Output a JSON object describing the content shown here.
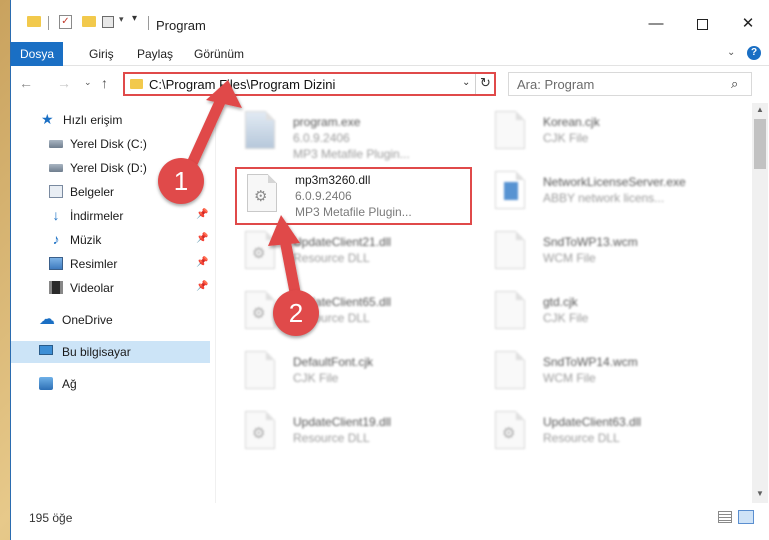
{
  "window": {
    "title": "Program",
    "controls": {
      "minimize": "—",
      "maximize": "",
      "close": "✕"
    }
  },
  "ribbon": {
    "tabs": [
      "Dosya",
      "Giriş",
      "Paylaş",
      "Görünüm"
    ],
    "help": "?"
  },
  "address_bar": {
    "path": "C:\\Program Files\\Program Dizini",
    "search_placeholder": "Ara: Program"
  },
  "nav_pane": {
    "items": [
      {
        "label": "Hızlı erişim",
        "icon": "star-icon",
        "pinned": false
      },
      {
        "label": "Yerel Disk (C:)",
        "icon": "drive-icon",
        "pinned": false
      },
      {
        "label": "Yerel Disk (D:)",
        "icon": "drive-icon",
        "pinned": false
      },
      {
        "label": "Belgeler",
        "icon": "documents-icon",
        "pinned": false
      },
      {
        "label": "İndirmeler",
        "icon": "download-icon",
        "pinned": true
      },
      {
        "label": "Müzik",
        "icon": "music-icon",
        "pinned": true
      },
      {
        "label": "Resimler",
        "icon": "pictures-icon",
        "pinned": true
      },
      {
        "label": "Videolar",
        "icon": "videos-icon",
        "pinned": true
      },
      {
        "label": "OneDrive",
        "icon": "onedrive-icon",
        "pinned": false
      },
      {
        "label": "Bu bilgisayar",
        "icon": "computer-icon",
        "pinned": false,
        "selected": true
      },
      {
        "label": "Ağ",
        "icon": "network-icon",
        "pinned": false
      }
    ]
  },
  "files": {
    "left": [
      {
        "name": "program.exe",
        "line2": "6.0.9.2406",
        "line3": "MP3 Metafile Plugin...",
        "icon": "exe-icon"
      },
      {
        "name": "mp3m3260.dll",
        "line2": "6.0.9.2406",
        "line3": "MP3 Metafile Plugin...",
        "icon": "dll-gear-icon",
        "selected": true
      },
      {
        "name": "UpdateClient21.dll",
        "line2": "Resource DLL",
        "line3": "",
        "icon": "dll-gear-icon"
      },
      {
        "name": "UpdateClient65.dll",
        "line2": "Resource DLL",
        "line3": "",
        "icon": "dll-gear-icon"
      },
      {
        "name": "DefaultFont.cjk",
        "line2": "CJK File",
        "line3": "",
        "icon": "file-icon"
      },
      {
        "name": "UpdateClient19.dll",
        "line2": "Resource DLL",
        "line3": "",
        "icon": "dll-gear-icon"
      }
    ],
    "right": [
      {
        "name": "Korean.cjk",
        "line2": "CJK File",
        "line3": "",
        "icon": "file-icon"
      },
      {
        "name": "NetworkLicenseServer.exe",
        "line2": "ABBY network licens...",
        "line3": "",
        "icon": "app-icon"
      },
      {
        "name": "SndToWP13.wcm",
        "line2": "WCM File",
        "line3": "",
        "icon": "file-icon"
      },
      {
        "name": "gtd.cjk",
        "line2": "CJK File",
        "line3": "",
        "icon": "file-icon"
      },
      {
        "name": "SndToWP14.wcm",
        "line2": "WCM File",
        "line3": "",
        "icon": "file-icon"
      },
      {
        "name": "UpdateClient63.dll",
        "line2": "Resource DLL",
        "line3": "",
        "icon": "dll-gear-icon"
      }
    ]
  },
  "status": {
    "count": "195 öğe"
  },
  "annotations": {
    "badge1": "1",
    "badge2": "2"
  },
  "colors": {
    "accent": "#1a6fc4",
    "annotation": "#e04a4a",
    "selected_nav": "#cce4f7"
  }
}
